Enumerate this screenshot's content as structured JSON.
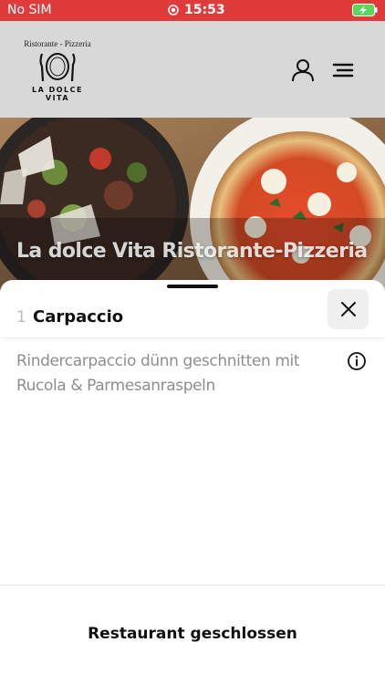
{
  "status_bar": {
    "carrier": "No SIM",
    "time": "15:53",
    "colors": {
      "background": "#e03b3b",
      "battery": "#5cd65c"
    }
  },
  "header": {
    "logo": {
      "top_text": "Ristorante - Pizzeria",
      "bottom_text": "LA DOLCE VITA"
    },
    "icons": [
      "user-icon",
      "menu-icon"
    ]
  },
  "hero": {
    "title": "La dolce Vita Ristorante-Pizzeria"
  },
  "item_sheet": {
    "number": "1",
    "name": "Carpaccio",
    "description": "Rindercarpaccio dünn geschnitten mit Rucola & Parmesanraspeln",
    "icons": [
      "close-icon",
      "info-icon"
    ]
  },
  "footer": {
    "status_text": "Restaurant geschlossen"
  }
}
